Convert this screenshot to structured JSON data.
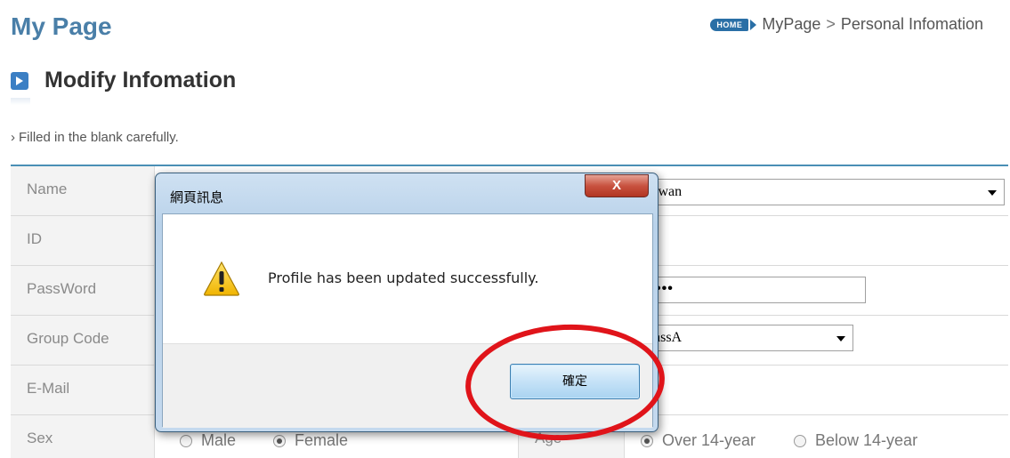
{
  "page": {
    "title": "My Page"
  },
  "breadcrumb": {
    "home_badge": "HOME",
    "items": [
      "MyPage",
      "Personal Infomation"
    ],
    "separator": ">"
  },
  "section": {
    "title": "Modify Infomation",
    "hint": "Filled in the blank carefully."
  },
  "form": {
    "rows": [
      {
        "label": "Name",
        "value": "iwan"
      },
      {
        "label": "ID",
        "value": ""
      },
      {
        "label": "PassWord",
        "value": "•••"
      },
      {
        "label": "Group Code",
        "value": "assA"
      },
      {
        "label": "E-Mail",
        "value": ""
      },
      {
        "label": "Sex",
        "value": ""
      }
    ],
    "sex": {
      "options": [
        "Male",
        "Female"
      ],
      "selected": "Female"
    },
    "age": {
      "label": "Age",
      "options": [
        "Over 14-year",
        "Below 14-year"
      ],
      "selected": "Over 14-year"
    }
  },
  "dialog": {
    "title": "網頁訊息",
    "close_label": "X",
    "message": "Profile has been updated successfully.",
    "ok_label": "確定",
    "icon": "warning-icon"
  },
  "colors": {
    "accent": "#4a7fa8",
    "highlight": "#e0141a",
    "table_border": "#4a8fb5"
  }
}
